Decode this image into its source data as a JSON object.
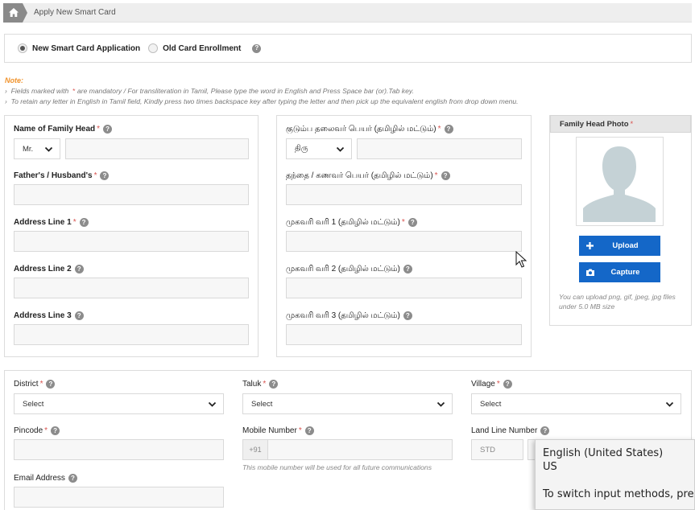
{
  "breadcrumb": {
    "current": "Apply New Smart Card"
  },
  "application_type": {
    "options": [
      {
        "label": "New Smart Card Application",
        "selected": true
      },
      {
        "label": "Old Card Enrollment",
        "selected": false
      }
    ]
  },
  "note": {
    "title": "Note:",
    "line1_prefix": "Fields marked with",
    "line1_star": "*",
    "line1_suffix": "are mandatory  / For transliteration in Tamil, Please type the word in English and Press Space bar (or).Tab key.",
    "line2": "To retain any letter in English in Tamil field, Kindly press two times backspace key after typing the letter and then pick up the equivalent english from drop down menu."
  },
  "english_form": {
    "family_head_label": "Name of Family Head",
    "title_value": "Mr.",
    "father_label": "Father's / Husband's",
    "address1_label": "Address Line 1",
    "address2_label": "Address Line 2",
    "address3_label": "Address Line 3"
  },
  "tamil_form": {
    "family_head_label": "குடும்ப தலைவர் பெயர் (தமிழில் மட்டும்)",
    "title_value": "திரு",
    "father_label": "தந்தை / கணவர் பெயர் (தமிழில் மட்டும்)",
    "address1_label": "முகவரி வரி 1 (தமிழில் மட்டும்)",
    "address2_label": "முகவரி வரி 2 (தமிழில் மட்டும்)",
    "address3_label": "முகவரி வரி 3 (தமிழில் மட்டும்)"
  },
  "photo": {
    "header": "Family Head Photo",
    "upload_label": "Upload",
    "capture_label": "Capture",
    "hint": "You can upload png, gif, jpeg, jpg files under 5.0 MB size"
  },
  "location": {
    "district_label": "District",
    "district_value": "Select",
    "taluk_label": "Taluk",
    "taluk_value": "Select",
    "village_label": "Village",
    "village_value": "Select",
    "pincode_label": "Pincode",
    "mobile_label": "Mobile Number",
    "mobile_prefix": "+91",
    "mobile_hint": "This mobile number will be used for all future communications",
    "landline_label": "Land Line Number",
    "std_placeholder": "STD",
    "email_label": "Email Address"
  },
  "ime_tooltip": {
    "language": "English (United States)",
    "layout": "US",
    "hint": "To switch input methods, press"
  },
  "colors": {
    "accent_blue": "#1467c8",
    "required_red": "#d9534f",
    "note_orange": "#f0922b"
  }
}
